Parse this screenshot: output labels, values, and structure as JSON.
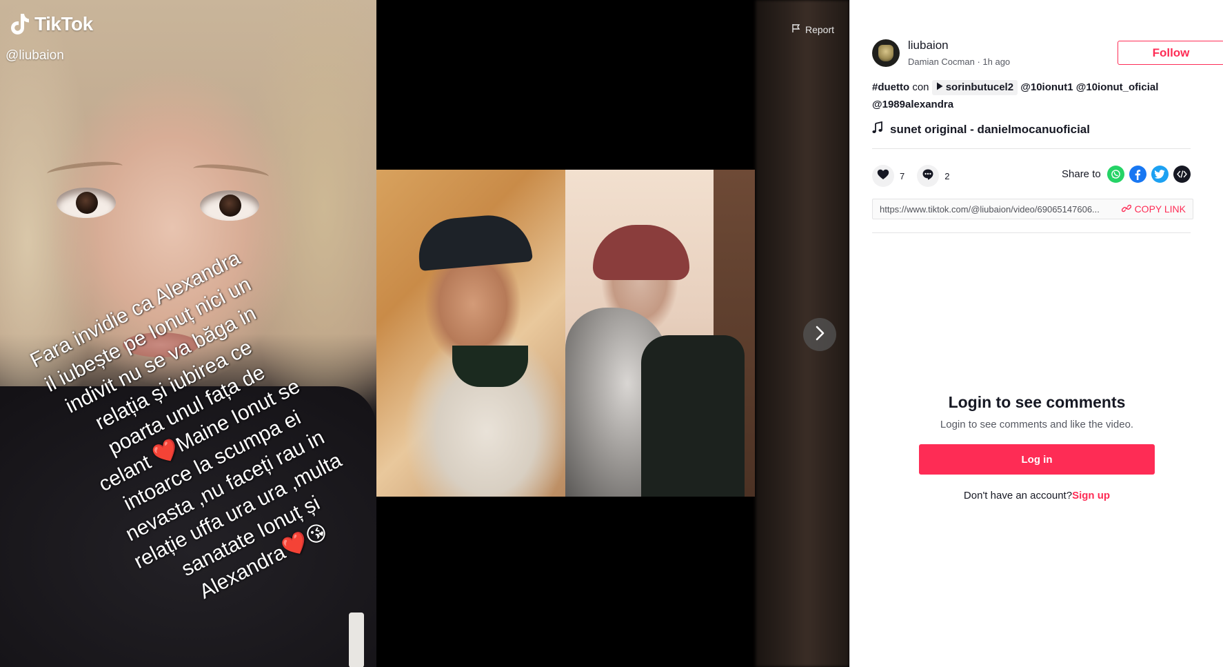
{
  "video": {
    "watermark_brand": "TikTok",
    "watermark_handle": "@liubaion",
    "report_label": "Report",
    "caption_lines": [
      "Fara invidie ca Alexandra",
      "il iubește pe Ionuț nici un",
      "indivit nu se va băga in",
      "relația și iubirea ce",
      "poarta unul fața de",
      "celant ❤️Maine Ionut se",
      "intoarce la scumpa ei",
      "nevasta ,nu faceți rau in",
      "relație uffa ura ura ,multa",
      "sanatate Ionuț și",
      "Alexandra❤️😘"
    ]
  },
  "author": {
    "username": "liubaion",
    "display_name": "Damian Cocman",
    "separator": " · ",
    "time_ago": "1h ago",
    "follow_label": "Follow"
  },
  "description": {
    "hashtag": "#duetto",
    "connector": "con",
    "duet_user": "sorinbutucel2",
    "mentions": [
      "@10ionut1",
      "@10ionut_oficial",
      "@1989alexandra"
    ]
  },
  "music": {
    "title": "sunet original - danielmocanuoficial"
  },
  "stats": {
    "likes": "7",
    "comments": "2"
  },
  "share": {
    "label": "Share to",
    "icons": [
      "whatsapp-icon",
      "facebook-icon",
      "twitter-icon",
      "embed-icon"
    ],
    "link": "https://www.tiktok.com/@liubaion/video/69065147606...",
    "copy_label": "COPY LINK"
  },
  "login": {
    "title": "Login to see comments",
    "subtitle": "Login to see comments and like the video.",
    "button": "Log in",
    "no_account": "Don't have an account?",
    "signup": "Sign up"
  },
  "colors": {
    "brand": "#fe2c55",
    "whatsapp": "#25d366",
    "facebook": "#1877f2",
    "twitter": "#1da1f2",
    "embed": "#161823"
  }
}
